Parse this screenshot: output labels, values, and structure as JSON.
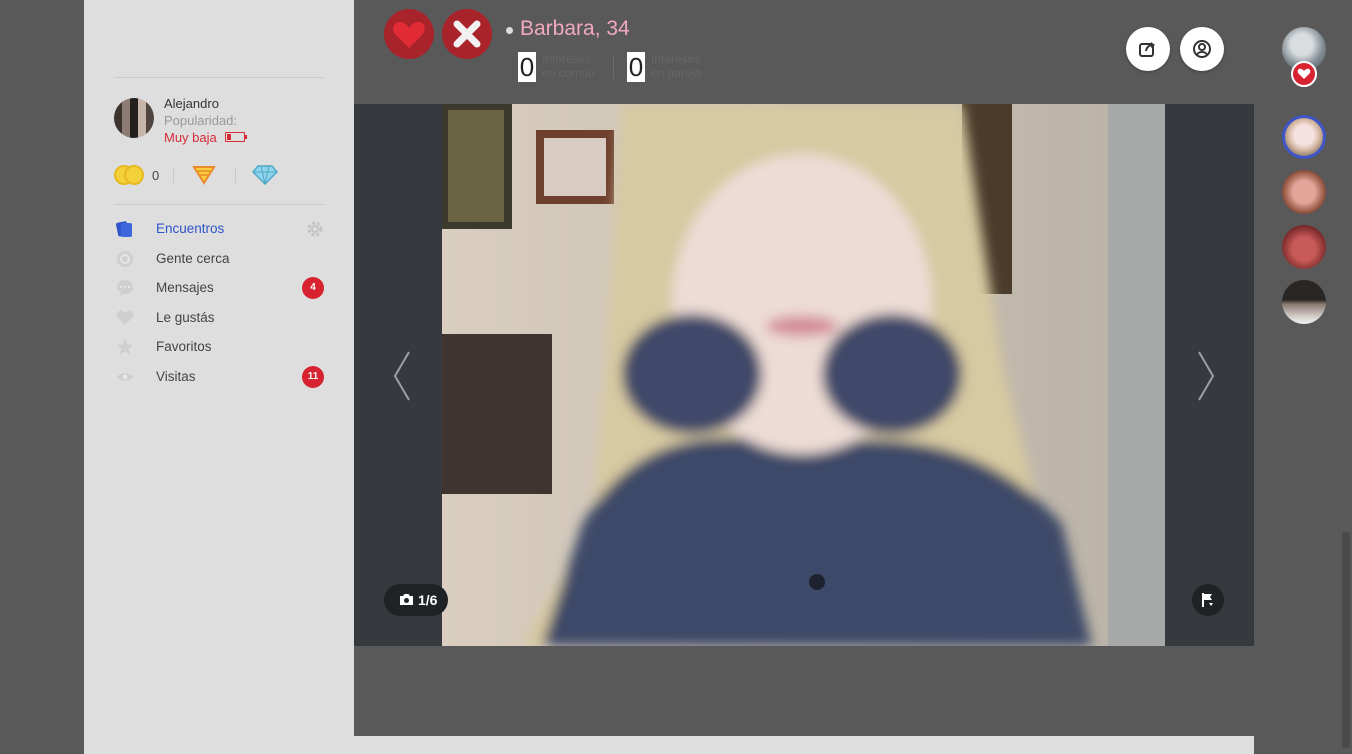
{
  "user": {
    "name": "Alejandro",
    "popularity_label": "Popularidad:",
    "popularity_level": "Muy baja",
    "credits": "0"
  },
  "nav": {
    "items": [
      {
        "label": "Encuentros",
        "icon": "cards-icon",
        "active": true
      },
      {
        "label": "Gente cerca",
        "icon": "location-icon"
      },
      {
        "label": "Mensajes",
        "icon": "chat-icon",
        "badge": "4"
      },
      {
        "label": "Le gustás",
        "icon": "heart-icon"
      },
      {
        "label": "Favoritos",
        "icon": "star-icon"
      },
      {
        "label": "Visitas",
        "icon": "eye-icon",
        "badge": "11"
      }
    ]
  },
  "profile": {
    "title": "Barbara, 34",
    "stats": [
      {
        "value": "0",
        "label_line1": "Intereses",
        "label_line2": "en común"
      },
      {
        "value": "0",
        "label_line1": "Intereses",
        "label_line2": "en pareja"
      }
    ]
  },
  "photo": {
    "counter": "1/6"
  },
  "colors": {
    "accent_blue": "#2f55c8",
    "action_red": "#a8242a",
    "badge_red": "#d7222f",
    "name_pink": "#f2a9be",
    "sidebar_bg": "#dedede",
    "page_bg": "#595959"
  }
}
